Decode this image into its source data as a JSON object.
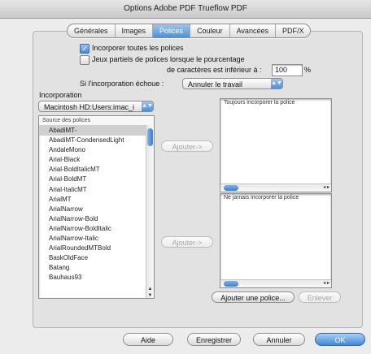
{
  "window": {
    "title": "Options Adobe PDF  Trueflow PDF"
  },
  "tabs": [
    {
      "label": "Générales",
      "active": false
    },
    {
      "label": "Images",
      "active": false
    },
    {
      "label": "Polices",
      "active": true
    },
    {
      "label": "Couleur",
      "active": false
    },
    {
      "label": "Avancées",
      "active": false
    },
    {
      "label": "PDF/X",
      "active": false
    }
  ],
  "options": {
    "embed_all": {
      "label": "Incorporer toutes les polices",
      "checked": true
    },
    "subset": {
      "label_line1": "Jeux partiels de polices lorsque le pourcentage",
      "label_line2": "de caractères est inférieur à :",
      "checked": false,
      "value": "100",
      "unit": "%"
    },
    "on_fail": {
      "label": "Si l'incorporation échoue :",
      "value": "Annuler le travail"
    }
  },
  "incorporation": {
    "section_label": "Incorporation",
    "source_popup": "Macintosh HD:Users:imac_i",
    "source_header": "Source des polices",
    "fonts": [
      "AbadiMT-",
      "AbadiMT-CondensedLight",
      "AndaleMono",
      "Arial-Black",
      "Arial-BoldItalicMT",
      "Arial-BoldMT",
      "Arial-ItalicMT",
      "ArialMT",
      "ArialNarrow",
      "ArialNarrow-Bold",
      "ArialNarrow-BoldItalic",
      "ArialNarrow-Italic",
      "ArialRoundedMTBold",
      "BaskOldFace",
      "Batang",
      "Bauhaus93"
    ],
    "add_button_1": "Ajouter->",
    "add_button_2": "Ajouter->",
    "always_header": "Toujours incorporer la police",
    "never_header": "Ne jamais incorporer la police",
    "add_font_button": "Ajouter une police...",
    "remove_button": "Enlever"
  },
  "footer": {
    "help": "Aide",
    "save": "Enregistrer",
    "cancel": "Annuler",
    "ok": "OK"
  }
}
